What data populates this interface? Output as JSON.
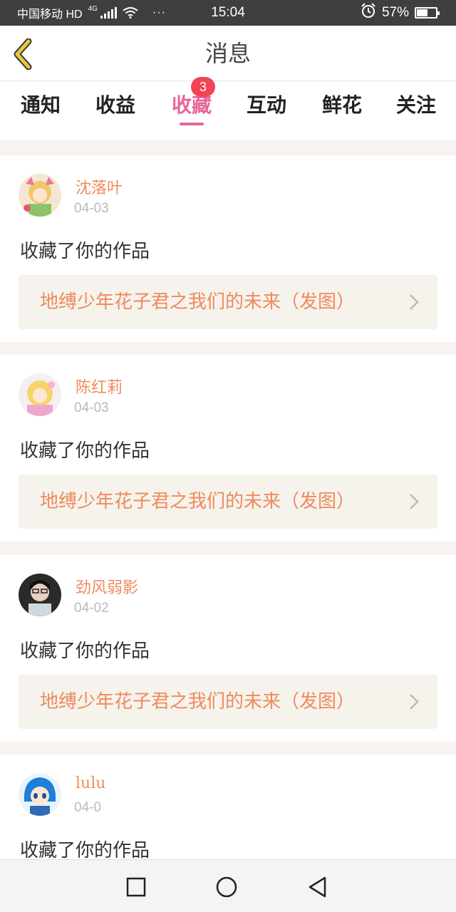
{
  "status_bar": {
    "carrier": "中国移动 HD",
    "network": "4G",
    "dots": "···",
    "time": "15:04",
    "battery_percent": "57%",
    "battery_level": 0.57
  },
  "header": {
    "title": "消息",
    "back_icon": "chevron-left-icon",
    "accent_color": "#e9c83a"
  },
  "tabs": [
    {
      "label": "通知",
      "active": false
    },
    {
      "label": "收益",
      "active": false
    },
    {
      "label": "收藏",
      "active": true,
      "badge": "3"
    },
    {
      "label": "互动",
      "active": false
    },
    {
      "label": "鲜花",
      "active": false
    },
    {
      "label": "关注",
      "active": false
    }
  ],
  "cards": [
    {
      "username": "沈落叶",
      "date": "04-03",
      "action": "收藏了你的作品",
      "work_title": "地缚少年花子君之我们的未来（发图）"
    },
    {
      "username": "陈红莉",
      "date": "04-03",
      "action": "收藏了你的作品",
      "work_title": "地缚少年花子君之我们的未来（发图）"
    },
    {
      "username": "劲风弱影",
      "date": "04-02",
      "action": "收藏了你的作品",
      "work_title": "地缚少年花子君之我们的未来（发图）"
    },
    {
      "username": "lulu",
      "date": "04-0",
      "action": "收藏了你的作品",
      "work_title": ""
    }
  ],
  "colors": {
    "active_tab": "#e9649c",
    "badge": "#f34456",
    "username": "#f08a5d",
    "link_bg": "#f5f3ec"
  },
  "system_nav": [
    "square-icon",
    "circle-icon",
    "triangle-back-icon"
  ]
}
